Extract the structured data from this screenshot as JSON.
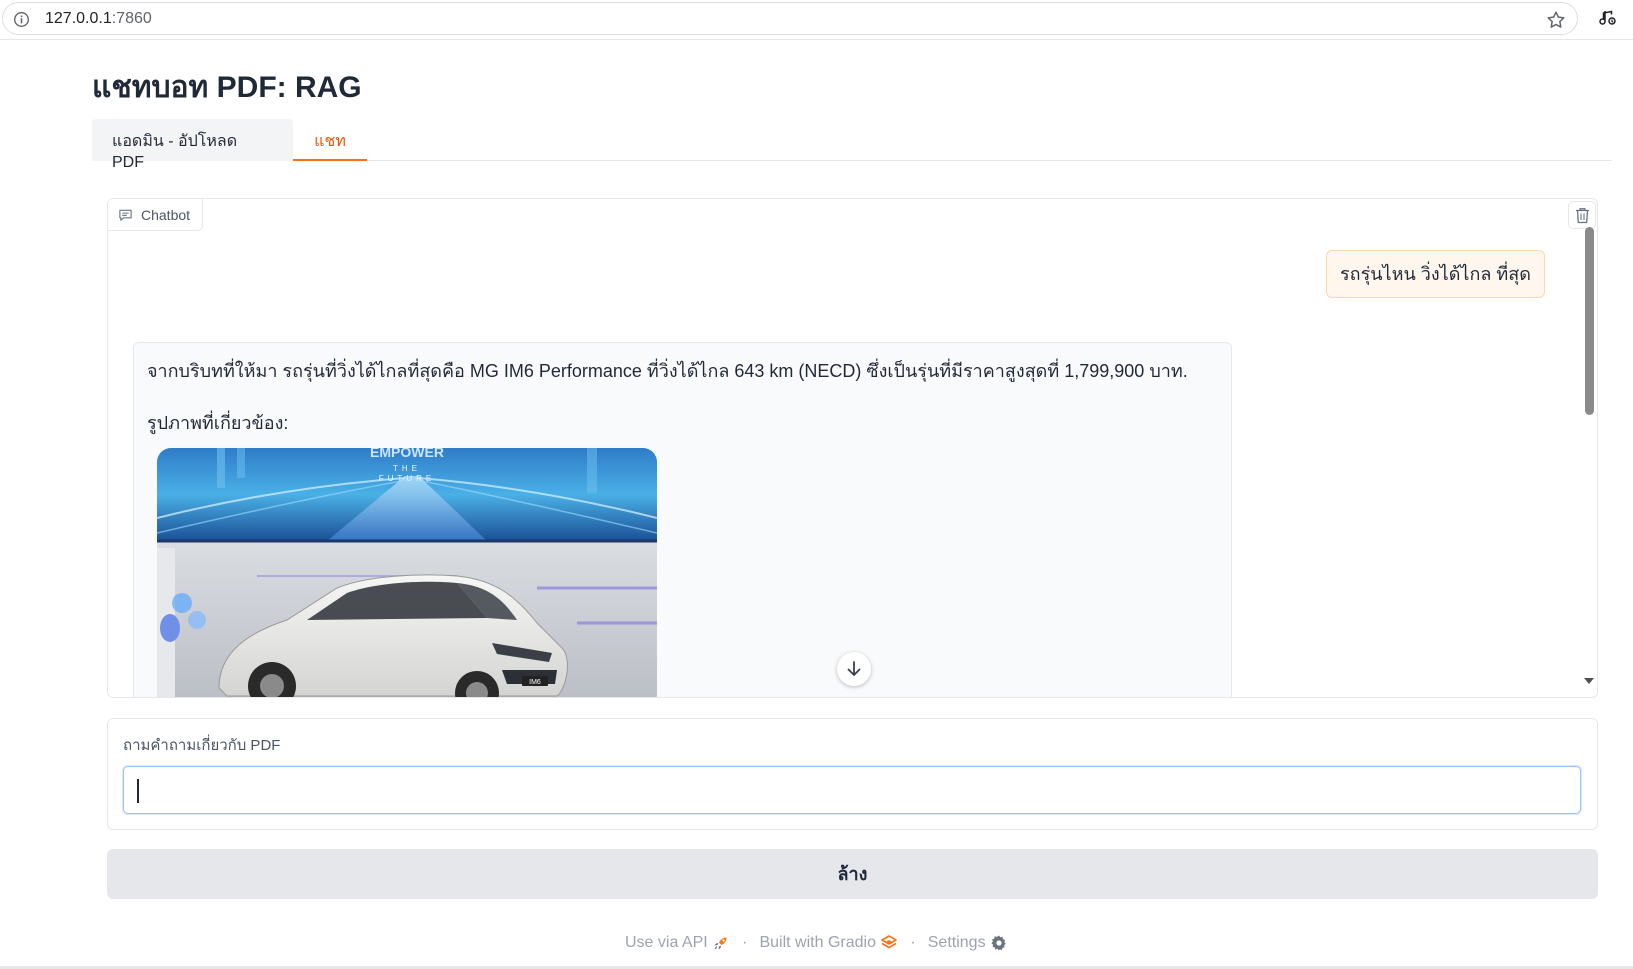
{
  "browser": {
    "url_host": "127.0.0.1",
    "url_port": ":7860"
  },
  "app": {
    "title": "แชทบอท PDF: RAG"
  },
  "tabs": [
    {
      "label": "แอดมิน - อัปโหลด PDF",
      "active": false
    },
    {
      "label": "แชท",
      "active": true
    }
  ],
  "chatbot": {
    "label": "Chatbot",
    "messages": {
      "user": "รถรุ่นไหน วิ่งได้ไกล ที่สุด",
      "bot_text": "จากบริบทที่ให้มา รถรุ่นที่วิ่งได้ไกลที่สุดคือ MG IM6 Performance ที่วิ่งได้ไกล 643 km (NECD) ซึ่งเป็นรุ่นที่มีราคาสูงสุดที่ 1,799,900 บาท.",
      "bot_images_label": "รูปภาพที่เกี่ยวข้อง:"
    },
    "image_overlay": {
      "banner_line1": "EMPOWER",
      "banner_line2": "THE",
      "banner_line3": "FUTURE",
      "car_badge": "IM6"
    }
  },
  "question_input": {
    "label": "ถามคำถามเกี่ยวกับ PDF",
    "value": "",
    "placeholder": ""
  },
  "clear_button": {
    "label": "ล้าง"
  },
  "footer": {
    "api_link": "Use via API",
    "built_with": "Built with Gradio",
    "settings": "Settings"
  },
  "colors": {
    "accent": "#f97316",
    "user_bubble_bg": "#fff7ed",
    "user_bubble_border": "#fed7aa",
    "bot_bubble_bg": "#f9fafb",
    "button_bg": "#e5e7eb"
  }
}
